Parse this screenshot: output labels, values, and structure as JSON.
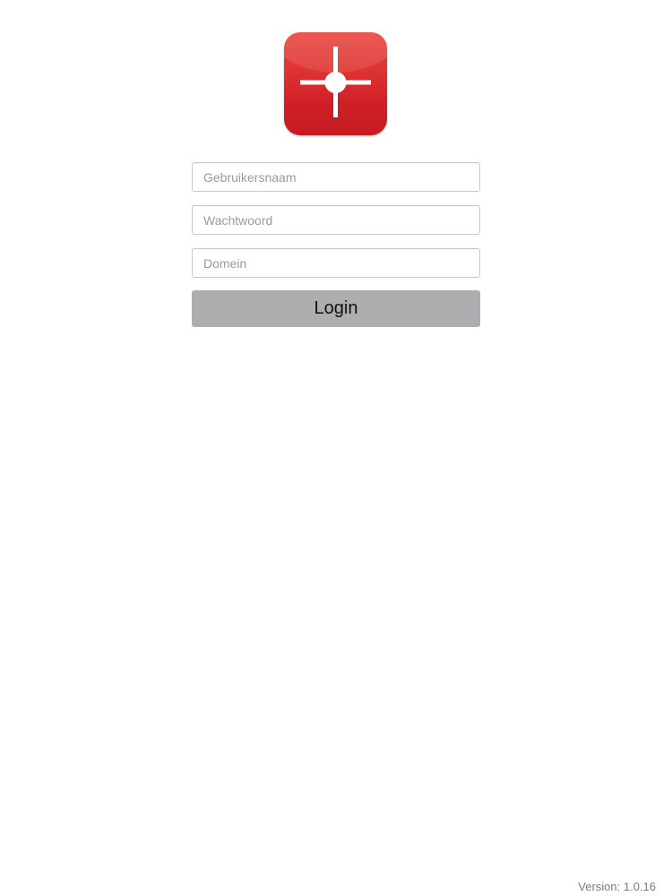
{
  "logo": {
    "icon": "crosshair-icon",
    "background_color": "#d42a2e",
    "mark_color": "#ffffff"
  },
  "form": {
    "username": {
      "placeholder": "Gebruikersnaam",
      "value": ""
    },
    "password": {
      "placeholder": "Wachtwoord",
      "value": ""
    },
    "domain": {
      "placeholder": "Domein",
      "value": ""
    },
    "login_label": "Login",
    "login_button_color": "#aeadb0"
  },
  "footer": {
    "version": "Version: 1.0.16"
  }
}
